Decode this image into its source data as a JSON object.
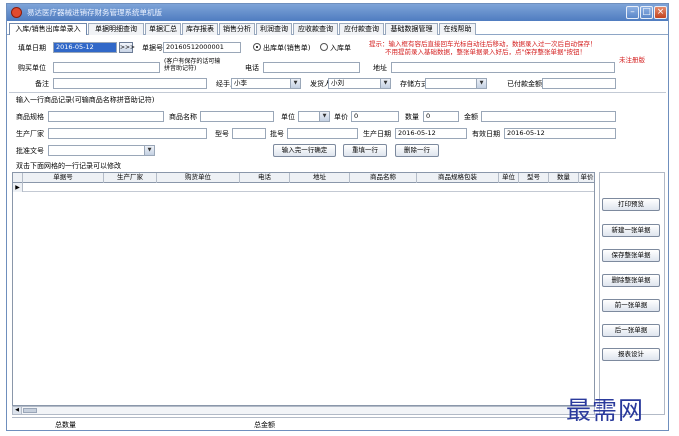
{
  "window": {
    "title": "易达医疗器械进销存财务管理系统单机版",
    "icons": {
      "app": "app-logo-icon",
      "minimize": "minimize-icon",
      "maximize": "maximize-icon",
      "close": "close-icon"
    }
  },
  "tabs": [
    {
      "label": "入库/销售出库单录入",
      "active": true
    },
    {
      "label": "单据明细查询"
    },
    {
      "label": "单据汇总"
    },
    {
      "label": "库存报表"
    },
    {
      "label": "销售分析"
    },
    {
      "label": "利润查询"
    },
    {
      "label": "应收款查询"
    },
    {
      "label": "应付款查询"
    },
    {
      "label": "基础数据管理"
    },
    {
      "label": "在线帮助"
    }
  ],
  "form": {
    "date_label": "填单日期",
    "date_value": "2016-05-12",
    "date_go_label": ">>>",
    "doc_no_label": "单据号",
    "doc_no_value": "20160512000001",
    "radio_out_label": "出库单(销售单)",
    "radio_in_label": "入库单",
    "hint_text": "提示：输入框有容后直接回车光标自动往后移动，数据录入过一次后自动保存！",
    "hint_text2": "不用提前录入基础数据，整张单据录入好后，点\"保存整张单据\"按钮！",
    "hint_text3": "未注册版",
    "buyer_label": "购买单位",
    "buyer_hint": "(客户有保存的话可输拼音助记符)",
    "phone_label": "电话",
    "address_label": "地址",
    "note_label": "备注",
    "handler_label": "经手人",
    "handler_value": "小李",
    "shipper_label": "发货人",
    "shipper_value": "小刘",
    "storage_label": "存储方式",
    "paid_label": "已付款金额"
  },
  "item_entry": {
    "section_label": "输入一行商品记录(可输商品名称拼音助记符)",
    "spec_label": "商品规格",
    "name_label": "商品名称",
    "unit_label": "单位",
    "price_label": "单价",
    "price_value": "0",
    "qty_label": "数量",
    "qty_value": "0",
    "amount_label": "金额",
    "maker_label": "生产厂家",
    "model_label": "型号",
    "batch_label": "批号",
    "mfg_date_label": "生产日期",
    "mfg_date_value": "2016-05-12",
    "exp_date_label": "有效日期",
    "exp_date_value": "2016-05-12",
    "approval_label": "批准文号",
    "btn_confirm": "输入完一行确定",
    "btn_refill": "重填一行",
    "btn_delete_row": "删除一行"
  },
  "grid": {
    "caption": "双击下面网格的一行记录可以修改",
    "columns": [
      "单据号",
      "生产厂家",
      "购货单位",
      "电话",
      "地址",
      "商品名称",
      "商品规格包装",
      "单位",
      "型号",
      "数量",
      "单价"
    ],
    "row_indicator": "▶"
  },
  "footer": {
    "total_qty_label": "总数量",
    "total_amount_label": "总金额"
  },
  "side_buttons": [
    "打印预览",
    "新建一张单据",
    "保存整张单据",
    "删除整张单据",
    "前一张单据",
    "后一张单据",
    "报表设计"
  ],
  "watermark": "最需网"
}
